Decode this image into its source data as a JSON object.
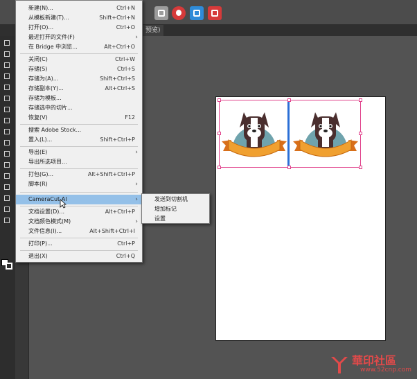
{
  "tab": {
    "label": "预览)"
  },
  "menu": {
    "items": [
      {
        "label": "新建(N)...",
        "shortcut": "Ctrl+N"
      },
      {
        "label": "从模板新建(T)...",
        "shortcut": "Shift+Ctrl+N"
      },
      {
        "label": "打开(O)...",
        "shortcut": "Ctrl+O"
      },
      {
        "label": "最近打开的文件(F)",
        "shortcut": ""
      },
      {
        "label": "在 Bridge 中浏览...",
        "shortcut": "Alt+Ctrl+O"
      },
      {
        "label": "关闭(C)",
        "shortcut": "Ctrl+W"
      },
      {
        "label": "存储(S)",
        "shortcut": "Ctrl+S"
      },
      {
        "label": "存储为(A)...",
        "shortcut": "Shift+Ctrl+S"
      },
      {
        "label": "存储副本(Y)...",
        "shortcut": "Alt+Ctrl+S"
      },
      {
        "label": "存储为模板...",
        "shortcut": ""
      },
      {
        "label": "存储选中的切片...",
        "shortcut": ""
      },
      {
        "label": "恢复(V)",
        "shortcut": "F12"
      },
      {
        "label": "搜索 Adobe Stock...",
        "shortcut": ""
      },
      {
        "label": "置入(L)...",
        "shortcut": "Shift+Ctrl+P"
      },
      {
        "label": "导出(E)",
        "shortcut": ""
      },
      {
        "label": "导出所选项目...",
        "shortcut": ""
      },
      {
        "label": "打包(G)...",
        "shortcut": "Alt+Shift+Ctrl+P"
      },
      {
        "label": "脚本(R)",
        "shortcut": ""
      },
      {
        "label": "CameraCut AI",
        "shortcut": ""
      },
      {
        "label": "文档设置(D)...",
        "shortcut": "Alt+Ctrl+P"
      },
      {
        "label": "文档颜色模式(M)",
        "shortcut": ""
      },
      {
        "label": "文件信息(I)...",
        "shortcut": "Alt+Shift+Ctrl+I"
      },
      {
        "label": "打印(P)...",
        "shortcut": "Ctrl+P"
      },
      {
        "label": "退出(X)",
        "shortcut": "Ctrl+Q"
      }
    ]
  },
  "submenu": {
    "items": [
      {
        "label": "发送到切割机"
      },
      {
        "label": "增加标记"
      },
      {
        "label": "设置"
      }
    ]
  },
  "watermark": {
    "text": "華印社區",
    "url": "www.52cnp.com"
  },
  "colors": {
    "highlight": "#94c0e8",
    "selection": "#e0408a",
    "canvas": "#535353"
  }
}
